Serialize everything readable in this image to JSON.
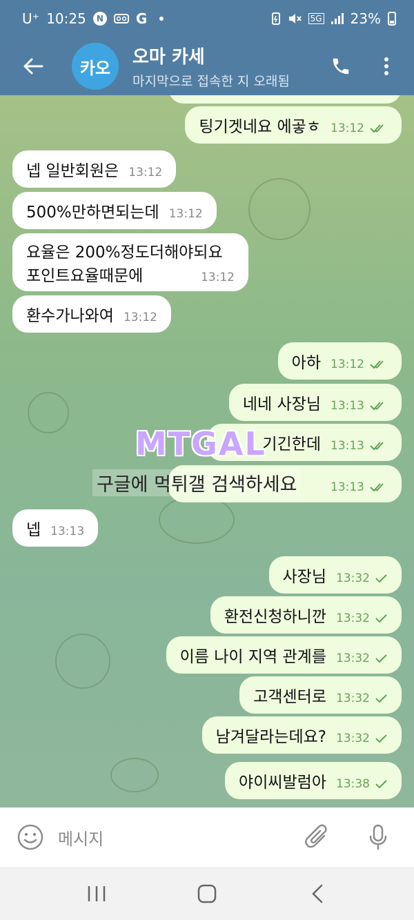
{
  "status_bar": {
    "carrier": "U⁺",
    "time": "10:25",
    "icons": [
      "n-icon",
      "voicemail-icon",
      "google-icon",
      "dot-icon",
      "battery-saver-icon",
      "mute-icon",
      "5g-icon",
      "signal-icon"
    ],
    "network": "5G",
    "battery": "23%"
  },
  "header": {
    "avatar_text": "카오",
    "title": "오마 카세",
    "subtitle": "마지막으로 접속한 지 오래됨",
    "colors": {
      "header_bg": "#517da2",
      "avatar_bg": "#3fa5e0"
    }
  },
  "messages": [
    {
      "dir": "out",
      "text": "팅기겟네요 에곻ㅎ",
      "time": "13:12",
      "ticks": "double"
    },
    {
      "dir": "in",
      "text": "넵 일반회원은",
      "time": "13:12"
    },
    {
      "dir": "in",
      "text": "500%만하면되는데",
      "time": "13:12"
    },
    {
      "dir": "in",
      "lines": [
        "요율은 200%정도더해야되요",
        "포인트요율때문에"
      ],
      "time": "13:12"
    },
    {
      "dir": "in",
      "text": "환수가나와여",
      "time": "13:12"
    },
    {
      "dir": "out",
      "text": "아하",
      "time": "13:12",
      "ticks": "double"
    },
    {
      "dir": "out",
      "text": "네네 사장님",
      "time": "13:13",
      "ticks": "double"
    },
    {
      "dir": "out",
      "text": "기긴한데",
      "time": "13:13",
      "ticks": "double"
    },
    {
      "dir": "out",
      "text": "",
      "time": "13:13",
      "ticks": "double"
    },
    {
      "dir": "in",
      "text": "넵",
      "time": "13:13"
    },
    {
      "dir": "out",
      "text": "사장님",
      "time": "13:32",
      "ticks": "single"
    },
    {
      "dir": "out",
      "text": "환전신청하니깐",
      "time": "13:32",
      "ticks": "single"
    },
    {
      "dir": "out",
      "text": "이름 나이 지역 관계를",
      "time": "13:32",
      "ticks": "single"
    },
    {
      "dir": "out",
      "text": "고객센터로",
      "time": "13:32",
      "ticks": "single"
    },
    {
      "dir": "out",
      "text": "남겨달라는데요?",
      "time": "13:32",
      "ticks": "single"
    },
    {
      "dir": "out",
      "text": "야이씨발럼아",
      "time": "13:38",
      "ticks": "single"
    }
  ],
  "watermark": {
    "logo": "MTGAL",
    "caption": "구글에 먹튀갤 검색하세요"
  },
  "input": {
    "placeholder": "메시지"
  },
  "colors": {
    "incoming_bubble": "#ffffff",
    "outgoing_bubble": "#effdde",
    "tick_color": "#5fa356"
  }
}
